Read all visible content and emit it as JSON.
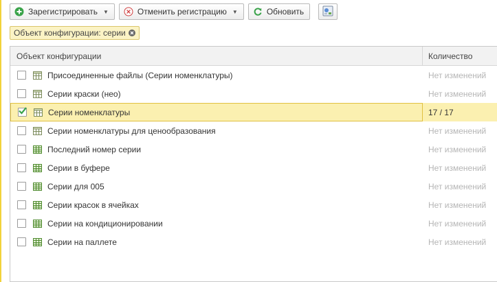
{
  "toolbar": {
    "register_label": "Зарегистрировать",
    "unregister_label": "Отменить регистрацию",
    "refresh_label": "Обновить"
  },
  "filter": {
    "label": "Объект конфигурации: серии"
  },
  "table": {
    "headers": {
      "object": "Объект конфигурации",
      "count": "Количество"
    },
    "rows": [
      {
        "name": "Присоединенные файлы (Серии номенклатуры)",
        "count": "Нет изменений",
        "checked": false,
        "icon": "catalog-icon"
      },
      {
        "name": "Серии краски (нео)",
        "count": "Нет изменений",
        "checked": false,
        "icon": "catalog-icon"
      },
      {
        "name": "Серии номенклатуры",
        "count": "17 / 17",
        "checked": true,
        "icon": "catalog-icon"
      },
      {
        "name": "Серии номенклатуры для ценообразования",
        "count": "Нет изменений",
        "checked": false,
        "icon": "catalog-icon"
      },
      {
        "name": "Последний номер серии",
        "count": "Нет изменений",
        "checked": false,
        "icon": "register-icon"
      },
      {
        "name": "Серии в буфере",
        "count": "Нет изменений",
        "checked": false,
        "icon": "register-icon"
      },
      {
        "name": "Серии для 005",
        "count": "Нет изменений",
        "checked": false,
        "icon": "register-icon"
      },
      {
        "name": "Серии красок в ячейках",
        "count": "Нет изменений",
        "checked": false,
        "icon": "register-icon"
      },
      {
        "name": "Серии на кондиционировании",
        "count": "Нет изменений",
        "checked": false,
        "icon": "register-icon"
      },
      {
        "name": "Серии на паллете",
        "count": "Нет изменений",
        "checked": false,
        "icon": "register-icon"
      }
    ]
  },
  "colors": {
    "accent_green": "#3aa34a",
    "selection": "#fbf0b0",
    "frame": "#f2d23a"
  }
}
